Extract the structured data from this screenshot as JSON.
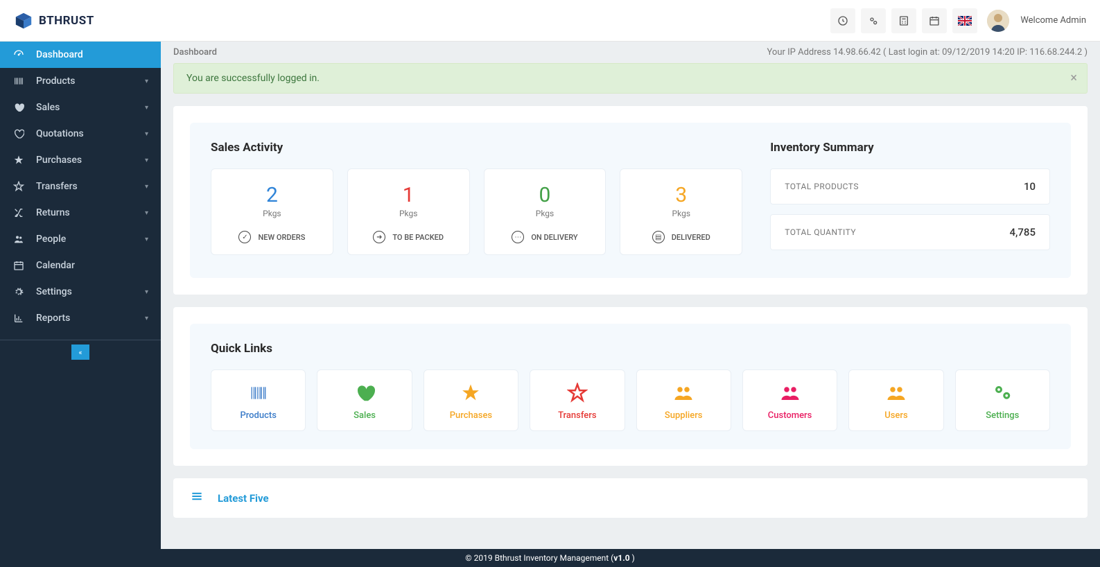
{
  "header": {
    "brand": "BTHRUST",
    "welcome": "Welcome Admin"
  },
  "breadcrumb": {
    "title": "Dashboard",
    "ip_info": "Your IP Address 14.98.66.42 ( Last login at: 09/12/2019 14:20 IP: 116.68.244.2 )"
  },
  "alert": {
    "message": "You are successfully logged in."
  },
  "sidebar": {
    "items": [
      {
        "label": "Dashboard",
        "expandable": false,
        "active": true
      },
      {
        "label": "Products",
        "expandable": true
      },
      {
        "label": "Sales",
        "expandable": true
      },
      {
        "label": "Quotations",
        "expandable": true
      },
      {
        "label": "Purchases",
        "expandable": true
      },
      {
        "label": "Transfers",
        "expandable": true
      },
      {
        "label": "Returns",
        "expandable": true
      },
      {
        "label": "People",
        "expandable": true
      },
      {
        "label": "Calendar",
        "expandable": false
      },
      {
        "label": "Settings",
        "expandable": true
      },
      {
        "label": "Reports",
        "expandable": true
      }
    ]
  },
  "sales_activity": {
    "title": "Sales Activity",
    "unit": "Pkgs",
    "cards": [
      {
        "value": "2",
        "label": "NEW ORDERS"
      },
      {
        "value": "1",
        "label": "TO BE PACKED"
      },
      {
        "value": "0",
        "label": "ON DELIVERY"
      },
      {
        "value": "3",
        "label": "DELIVERED"
      }
    ]
  },
  "inventory_summary": {
    "title": "Inventory Summary",
    "rows": [
      {
        "label": "TOTAL PRODUCTS",
        "value": "10"
      },
      {
        "label": "TOTAL QUANTITY",
        "value": "4,785"
      }
    ]
  },
  "quick_links": {
    "title": "Quick Links",
    "items": [
      {
        "label": "Products"
      },
      {
        "label": "Sales"
      },
      {
        "label": "Purchases"
      },
      {
        "label": "Transfers"
      },
      {
        "label": "Suppliers"
      },
      {
        "label": "Customers"
      },
      {
        "label": "Users"
      },
      {
        "label": "Settings"
      }
    ]
  },
  "latest": {
    "title": "Latest Five"
  },
  "footer": {
    "copyright_prefix": "© 2019 Bthrust Inventory Management (",
    "version": "v1.0",
    "copyright_suffix": " )"
  }
}
